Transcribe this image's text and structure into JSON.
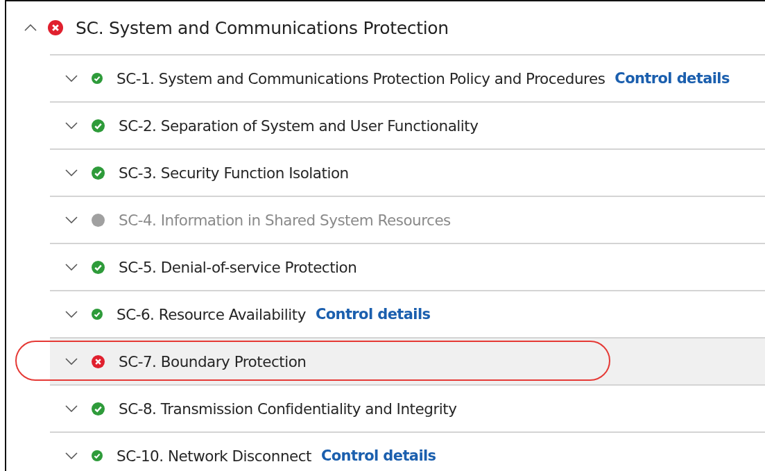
{
  "group": {
    "title": "SC. System and Communications Protection",
    "kind": "fail",
    "expanded": true
  },
  "controls": [
    {
      "title": "SC-1. System and Communications Protection Policy and Procedures",
      "kind": "pass",
      "expanded": false,
      "highlighted": false,
      "link": "Control details"
    },
    {
      "title": "SC-2. Separation of System and User Functionality",
      "kind": "pass",
      "expanded": false,
      "highlighted": false
    },
    {
      "title": "SC-3. Security Function Isolation",
      "kind": "pass",
      "expanded": false,
      "highlighted": false
    },
    {
      "title": "SC-4. Information in Shared System Resources",
      "kind": "none",
      "expanded": false,
      "highlighted": false
    },
    {
      "title": "SC-5. Denial-of-service Protection",
      "kind": "pass",
      "expanded": false,
      "highlighted": false
    },
    {
      "title": "SC-6. Resource Availability",
      "kind": "pass",
      "expanded": false,
      "highlighted": false,
      "link": "Control details"
    },
    {
      "title": "SC-7. Boundary Protection",
      "kind": "fail",
      "expanded": false,
      "highlighted": true
    },
    {
      "title": "SC-8. Transmission Confidentiality and Integrity",
      "kind": "pass",
      "expanded": false,
      "highlighted": false
    },
    {
      "title": "SC-10. Network Disconnect",
      "kind": "pass",
      "expanded": false,
      "highlighted": false,
      "link": "Control details"
    }
  ]
}
